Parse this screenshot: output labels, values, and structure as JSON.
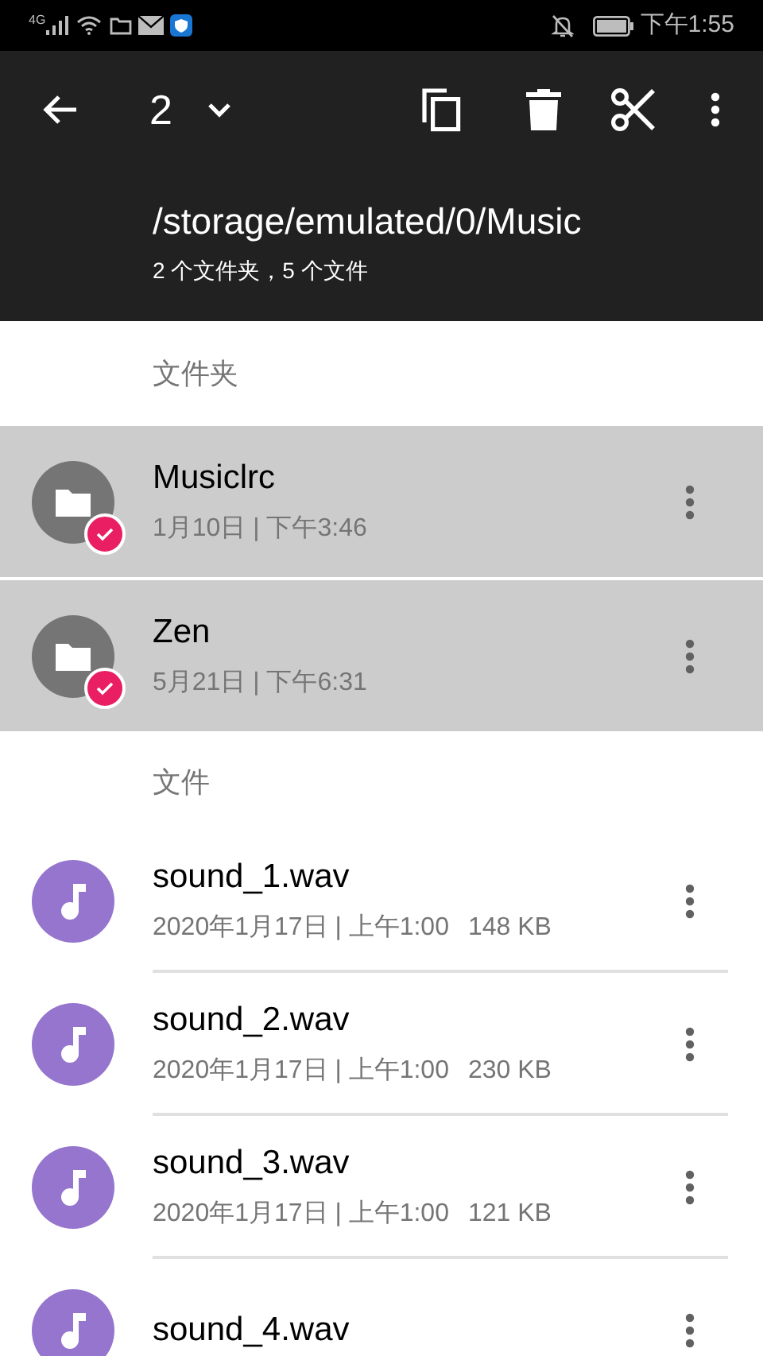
{
  "status_bar": {
    "network": "4G",
    "time": "下午1:55"
  },
  "toolbar": {
    "selection_count": "2"
  },
  "header": {
    "path": "/storage/emulated/0/Music",
    "summary": "2 个文件夹，5 个文件"
  },
  "sections": [
    {
      "title": "文件夹",
      "items": [
        {
          "kind": "folder",
          "name": "Musiclrc",
          "meta": "1月10日 | 下午3:46",
          "selected": true
        },
        {
          "kind": "folder",
          "name": "Zen",
          "meta": "5月21日 | 下午6:31",
          "selected": true
        }
      ]
    },
    {
      "title": "文件",
      "items": [
        {
          "kind": "audio",
          "name": "sound_1.wav",
          "meta": "2020年1月17日 | 上午1:00",
          "size": "148 KB",
          "selected": false
        },
        {
          "kind": "audio",
          "name": "sound_2.wav",
          "meta": "2020年1月17日 | 上午1:00",
          "size": "230 KB",
          "selected": false
        },
        {
          "kind": "audio",
          "name": "sound_3.wav",
          "meta": "2020年1月17日 | 上午1:00",
          "size": "121 KB",
          "selected": false
        },
        {
          "kind": "audio",
          "name": "sound_4.wav",
          "selected": false
        }
      ]
    }
  ]
}
